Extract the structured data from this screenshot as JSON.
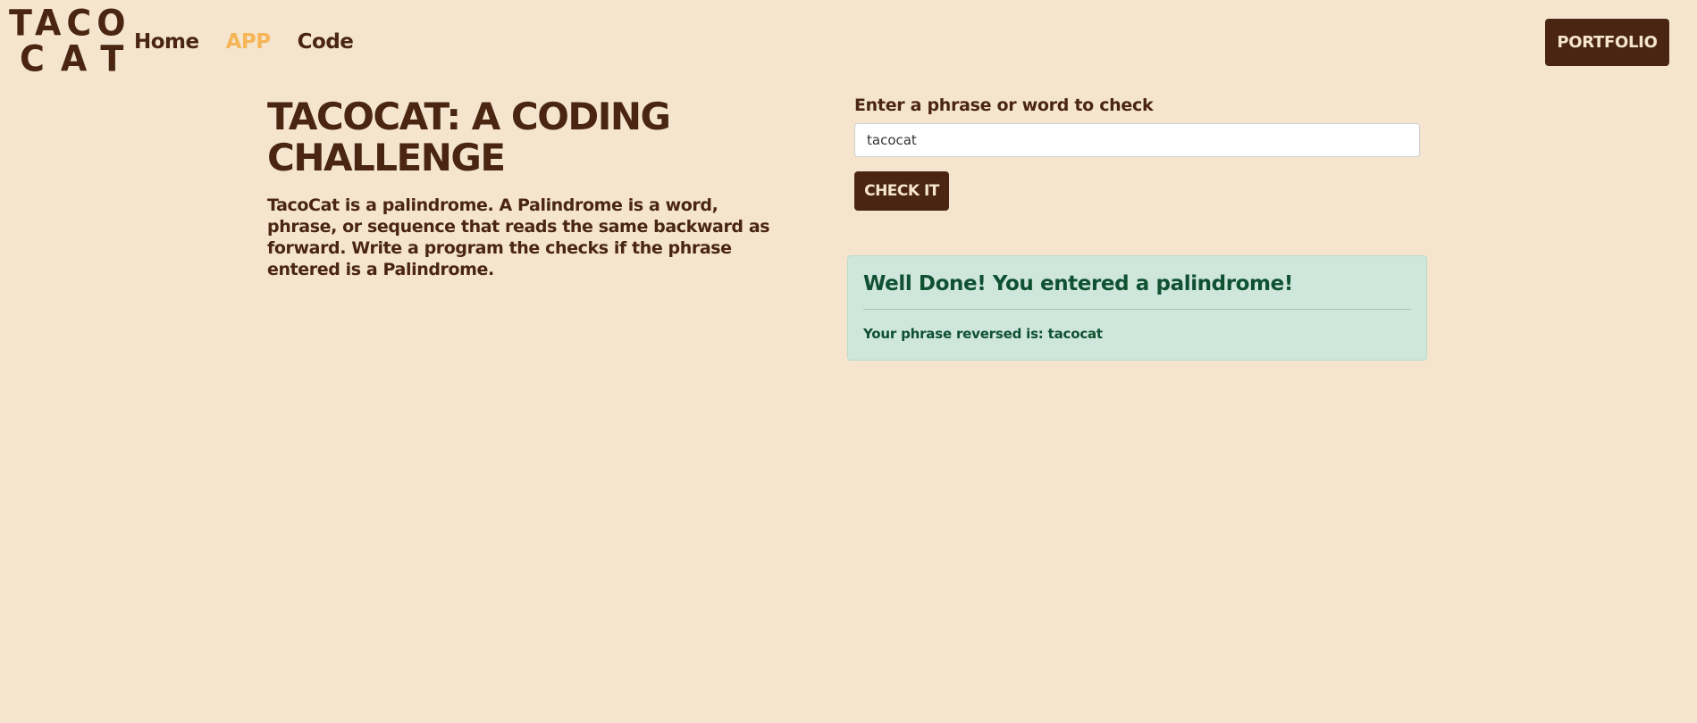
{
  "navbar": {
    "logo": {
      "line1": "TACO",
      "line2": "CAT"
    },
    "links": [
      {
        "label": "Home",
        "active": false
      },
      {
        "label": "APP",
        "active": true
      },
      {
        "label": "Code",
        "active": false
      }
    ],
    "portfolio_label": "PORTFOLIO"
  },
  "intro": {
    "title": "TacoCat: A Coding Challenge",
    "description_text": "TacoCat is a palindrome. A Palindrome is a word, phrase, or sequence that reads the same backward as forward. Write a program the checks if the phrase entered is a ",
    "description_emphasis": "Palindrome."
  },
  "form": {
    "label": "Enter a phrase or word to check",
    "input_value": "tacocat",
    "button_label": "Check It"
  },
  "result": {
    "heading": "Well Done! You entered a palindrome!",
    "message_prefix": "Your phrase reversed is: ",
    "reversed": "tacocat"
  },
  "colors": {
    "background": "#f5e5cf",
    "brand_brown": "#4a2612",
    "active_link": "#f5b657",
    "alert_bg": "#cfe6dc",
    "alert_text": "#0f5132"
  }
}
